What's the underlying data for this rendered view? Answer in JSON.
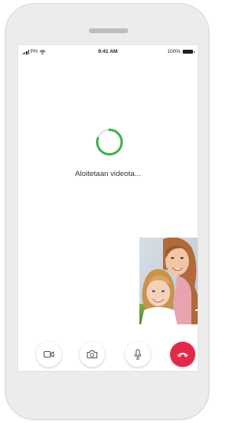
{
  "statusbar": {
    "carrier": "PH",
    "time": "9:41 AM",
    "battery": "100%"
  },
  "call": {
    "status_text": "Aloitetaan videota...",
    "loading_progress": 0.8
  },
  "controls": [
    {
      "name": "video-camera-icon"
    },
    {
      "name": "switch-camera-icon"
    },
    {
      "name": "microphone-icon"
    },
    {
      "name": "end-call-icon"
    }
  ],
  "colors": {
    "spinner_accent": "#3fb14a",
    "spinner_track": "#e8e8e8",
    "end_call": "#e2294b",
    "icon_gray": "#555555"
  }
}
